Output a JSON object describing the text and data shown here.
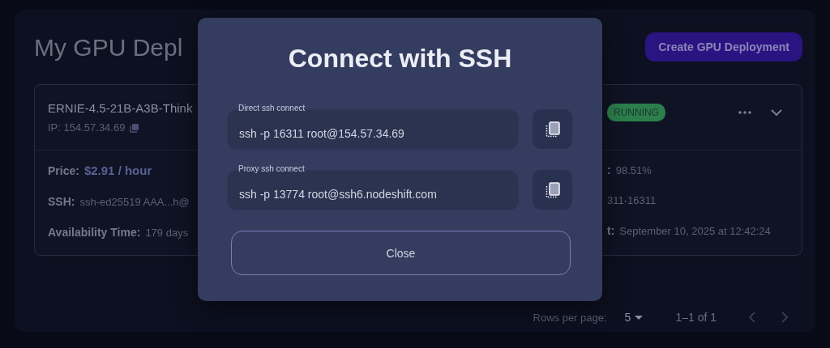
{
  "page": {
    "title": "My GPU Depl",
    "create_button": "Create GPU Deployment"
  },
  "deployment": {
    "name": "ERNIE-4.5-21B-A3B-Think",
    "ip": "IP: 154.57.34.69",
    "status": "RUNNING",
    "details_left": [
      {
        "label": "Price:",
        "value": "$2.91 / hour",
        "kind": "price"
      },
      {
        "label": "SSH:",
        "value": "ssh-ed25519 AAA...h@",
        "kind": "plain"
      },
      {
        "label": "Availability Time:",
        "value": "179 days",
        "kind": "plain"
      }
    ],
    "details_right": [
      {
        "label": ":",
        "value": "98.51%"
      },
      {
        "value": "311-16311"
      },
      {
        "label": "t:",
        "value": "September 10, 2025 at 12:42:24"
      }
    ]
  },
  "pagination": {
    "rows_per_page_label": "Rows per page:",
    "rows_per_page": "5",
    "range": "1–1 of 1"
  },
  "dialog": {
    "title": "Connect with SSH",
    "connections": [
      {
        "label": "Direct ssh connect",
        "value": "ssh -p 16311 root@154.57.34.69"
      },
      {
        "label": "Proxy ssh connect",
        "value": "ssh -p 13774 root@ssh6.nodeshift.com"
      }
    ],
    "close_button": "Close"
  }
}
